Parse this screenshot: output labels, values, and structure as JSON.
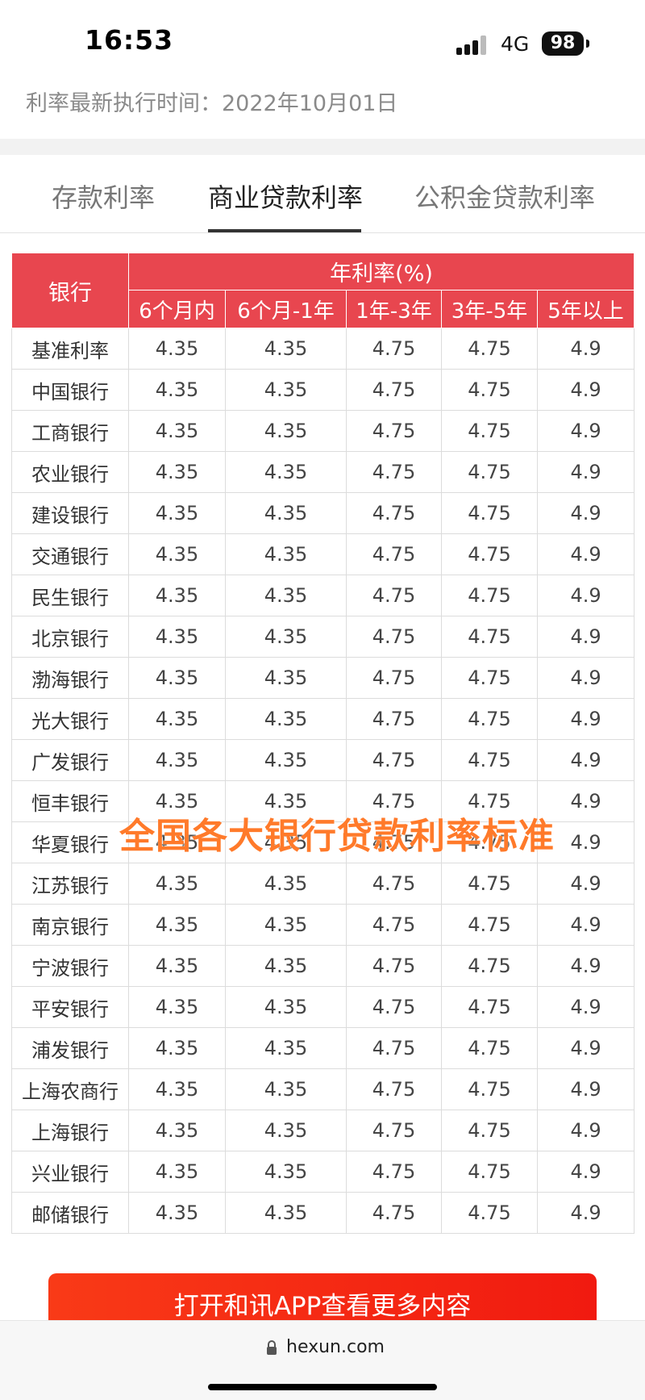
{
  "status": {
    "time": "16:53",
    "network": "4G",
    "battery": "98"
  },
  "update_line": "利率最新执行时间：2022年10月01日",
  "tabs": [
    {
      "label": "存款利率",
      "active": false
    },
    {
      "label": "商业贷款利率",
      "active": true
    },
    {
      "label": "公积金贷款利率",
      "active": false
    }
  ],
  "table": {
    "bank_header": "银行",
    "rate_header": "年利率(%)",
    "columns": [
      "6个月内",
      "6个月-1年",
      "1年-3年",
      "3年-5年",
      "5年以上"
    ],
    "rows": [
      {
        "bank": "基准利率",
        "values": [
          "4.35",
          "4.35",
          "4.75",
          "4.75",
          "4.9"
        ]
      },
      {
        "bank": "中国银行",
        "values": [
          "4.35",
          "4.35",
          "4.75",
          "4.75",
          "4.9"
        ]
      },
      {
        "bank": "工商银行",
        "values": [
          "4.35",
          "4.35",
          "4.75",
          "4.75",
          "4.9"
        ]
      },
      {
        "bank": "农业银行",
        "values": [
          "4.35",
          "4.35",
          "4.75",
          "4.75",
          "4.9"
        ]
      },
      {
        "bank": "建设银行",
        "values": [
          "4.35",
          "4.35",
          "4.75",
          "4.75",
          "4.9"
        ]
      },
      {
        "bank": "交通银行",
        "values": [
          "4.35",
          "4.35",
          "4.75",
          "4.75",
          "4.9"
        ]
      },
      {
        "bank": "民生银行",
        "values": [
          "4.35",
          "4.35",
          "4.75",
          "4.75",
          "4.9"
        ]
      },
      {
        "bank": "北京银行",
        "values": [
          "4.35",
          "4.35",
          "4.75",
          "4.75",
          "4.9"
        ]
      },
      {
        "bank": "渤海银行",
        "values": [
          "4.35",
          "4.35",
          "4.75",
          "4.75",
          "4.9"
        ]
      },
      {
        "bank": "光大银行",
        "values": [
          "4.35",
          "4.35",
          "4.75",
          "4.75",
          "4.9"
        ]
      },
      {
        "bank": "广发银行",
        "values": [
          "4.35",
          "4.35",
          "4.75",
          "4.75",
          "4.9"
        ]
      },
      {
        "bank": "恒丰银行",
        "values": [
          "4.35",
          "4.35",
          "4.75",
          "4.75",
          "4.9"
        ]
      },
      {
        "bank": "华夏银行",
        "values": [
          "4.35",
          "4.35",
          "4.75",
          "4.75",
          "4.9"
        ]
      },
      {
        "bank": "江苏银行",
        "values": [
          "4.35",
          "4.35",
          "4.75",
          "4.75",
          "4.9"
        ]
      },
      {
        "bank": "南京银行",
        "values": [
          "4.35",
          "4.35",
          "4.75",
          "4.75",
          "4.9"
        ]
      },
      {
        "bank": "宁波银行",
        "values": [
          "4.35",
          "4.35",
          "4.75",
          "4.75",
          "4.9"
        ]
      },
      {
        "bank": "平安银行",
        "values": [
          "4.35",
          "4.35",
          "4.75",
          "4.75",
          "4.9"
        ]
      },
      {
        "bank": "浦发银行",
        "values": [
          "4.35",
          "4.35",
          "4.75",
          "4.75",
          "4.9"
        ]
      },
      {
        "bank": "上海农商行",
        "values": [
          "4.35",
          "4.35",
          "4.75",
          "4.75",
          "4.9"
        ]
      },
      {
        "bank": "上海银行",
        "values": [
          "4.35",
          "4.35",
          "4.75",
          "4.75",
          "4.9"
        ]
      },
      {
        "bank": "兴业银行",
        "values": [
          "4.35",
          "4.35",
          "4.75",
          "4.75",
          "4.9"
        ]
      },
      {
        "bank": "邮储银行",
        "values": [
          "4.35",
          "4.35",
          "4.75",
          "4.75",
          "4.9"
        ]
      }
    ]
  },
  "overlay_caption": "全国各大银行贷款利率标准",
  "cta_label": "打开和讯APP查看更多内容",
  "browser": {
    "url": "hexun.com"
  },
  "colors": {
    "header_red": "#e8464f",
    "cta_red": "#f42a14",
    "overlay_orange": "#ff7a2a"
  }
}
